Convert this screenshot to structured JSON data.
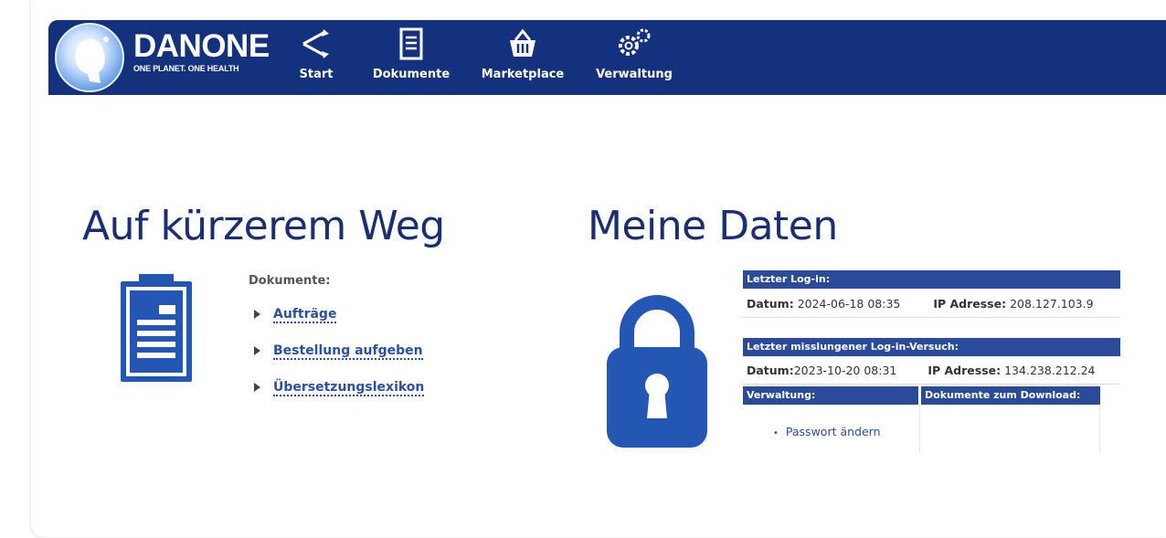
{
  "brand": {
    "name": "DANONE",
    "tagline": "ONE PLANET. ONE HEALTH"
  },
  "nav": {
    "items": [
      {
        "label": "Start",
        "icon": "share-branch-icon"
      },
      {
        "label": "Dokumente",
        "icon": "document-icon"
      },
      {
        "label": "Marketplace",
        "icon": "basket-icon"
      },
      {
        "label": "Verwaltung",
        "icon": "gears-icon"
      }
    ]
  },
  "shortcuts": {
    "title": "Auf kürzerem Weg",
    "documents_label": "Dokumente:",
    "links": [
      "Aufträge",
      "Bestellung aufgeben",
      "Übersetzungslexikon"
    ]
  },
  "mydata": {
    "title": "Meine Daten",
    "last_login": {
      "header": "Letzter Log-in:",
      "date_label": "Datum:",
      "date_value": "2024-06-18 08:35",
      "ip_label": "IP Adresse:",
      "ip_value": "208.127.103.9"
    },
    "last_failed": {
      "header": "Letzter misslungener Log-in-Versuch:",
      "date_label": "Datum:",
      "date_value": "2023-10-20 08:31",
      "ip_label": "IP Adresse:",
      "ip_value": "134.238.212.24"
    },
    "admin_header": "Verwaltung:",
    "downloads_header": "Dokumente zum Download:",
    "admin_links": [
      "Passwort ändern"
    ]
  },
  "colors": {
    "header_bg": "#14317e",
    "heading": "#1a2f73",
    "table_header": "#2a4a9a",
    "link": "#2a4fa6",
    "icon_blue": "#2456b3"
  }
}
